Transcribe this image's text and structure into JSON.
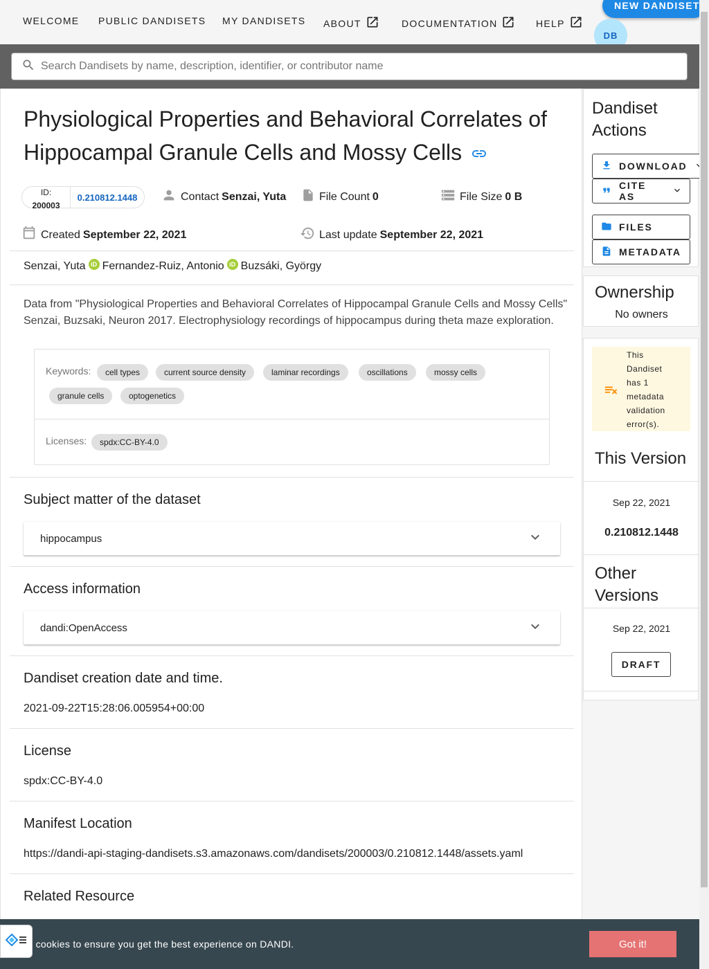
{
  "nav": {
    "items": [
      "WELCOME",
      "PUBLIC DANDISETS",
      "MY DANDISETS",
      "ABOUT",
      "DOCUMENTATION",
      "HELP"
    ],
    "new_button": "NEW DANDISET",
    "avatar_initials": "DB"
  },
  "search": {
    "placeholder": "Search Dandisets by name, description, identifier, or contributor name"
  },
  "dandiset": {
    "title": "Physiological Properties and Behavioral Correlates of Hippocampal Granule Cells and Mossy Cells",
    "id_label": "ID:",
    "id": "200003",
    "version": "0.210812.1448",
    "contact_label": "Contact",
    "contact": "Senzai, Yuta",
    "file_count_label": "File Count",
    "file_count": "0",
    "file_size_label": "File Size",
    "file_size": "0 B",
    "created_label": "Created",
    "created": "September 22, 2021",
    "updated_label": "Last update",
    "updated": "September 22, 2021",
    "authors": [
      "Senzai, Yuta",
      "Fernandez-Ruiz, Antonio",
      "Buzsáki, György"
    ],
    "description_line1": "Data from \"Physiological Properties and Behavioral Correlates of Hippocampal Granule Cells and Mossy Cells\"",
    "description_line2": "Senzai, Buzsaki, Neuron 2017. Electrophysiology recordings of hippocampus during theta maze exploration.",
    "keywords_label": "Keywords:",
    "keywords": [
      "cell types",
      "current source density",
      "laminar recordings",
      "oscillations",
      "mossy cells",
      "granule cells",
      "optogenetics"
    ],
    "licenses_label": "Licenses:",
    "licenses": [
      "spdx:CC-BY-4.0"
    ]
  },
  "sections": {
    "subject_title": "Subject matter of the dataset",
    "subject_value": "hippocampus",
    "access_title": "Access information",
    "access_value": "dandi:OpenAccess",
    "creation_title": "Dandiset creation date and time.",
    "creation_value": "2021-09-22T15:28:06.005954+00:00",
    "license_title": "License",
    "license_value": "spdx:CC-BY-4.0",
    "manifest_title": "Manifest Location",
    "manifest_value": "https://dandi-api-staging-dandisets.s3.amazonaws.com/dandisets/200003/0.210812.1448/assets.yaml",
    "related_title": "Related Resource"
  },
  "side": {
    "actions_title_1": "Dandiset",
    "actions_title_2": "Actions",
    "download": "DOWNLOAD",
    "cite": "CITE AS",
    "files": "FILES",
    "metadata": "METADATA",
    "ownership_title": "Ownership",
    "owners": "No owners",
    "validation_lines": [
      "This",
      "Dandiset",
      "has 1",
      "metadata",
      "validation",
      "error(s)."
    ],
    "this_version_title": "This Version",
    "this_version_date": "Sep 22, 2021",
    "this_version": "0.210812.1448",
    "other_title_1": "Other",
    "other_title_2": "Versions",
    "other_date": "Sep 22, 2021",
    "draft": "DRAFT"
  },
  "cookie": {
    "text": "se cookies to ensure you get the best experience on DANDI.",
    "button": "Got it!"
  },
  "colors": {
    "accent": "#1e88e5",
    "nav_bg": "#f5f5f5",
    "search_band": "#616161",
    "cookie_bg": "#37474f",
    "cookie_button": "#e57373",
    "warning_bg": "#fff8e1",
    "orcid": "#a6ce39"
  }
}
